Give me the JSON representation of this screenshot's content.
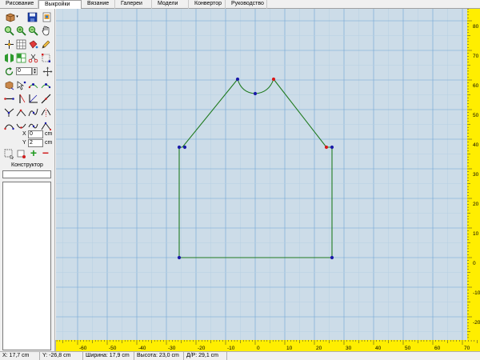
{
  "tabs": [
    {
      "label": "Рисование"
    },
    {
      "label": "Выкройки"
    },
    {
      "label": "Вязание"
    },
    {
      "label": "Галереи"
    },
    {
      "label": "Модели"
    },
    {
      "label": "Конвертор"
    },
    {
      "label": "Руководство"
    }
  ],
  "active_tab": "Выкройки",
  "panel": {
    "rotate_value": "0",
    "x_label": "X",
    "x_value": "0",
    "x_unit": "cm",
    "y_label": "Y",
    "y_value": "2",
    "y_unit": "cm",
    "add_symbol": "+",
    "remove_symbol": "−",
    "konstruktor_label": "Конструктор",
    "konstruktor_value": ""
  },
  "rulers": {
    "horizontal_labels": [
      "-60",
      "-50",
      "-40",
      "-30",
      "-20",
      "-10",
      "0",
      "10",
      "20",
      "30",
      "40",
      "50",
      "60",
      "70"
    ],
    "vertical_labels": [
      "80",
      "70",
      "60",
      "50",
      "40",
      "30",
      "20",
      "10",
      "0",
      "-10",
      "-20"
    ]
  },
  "status": {
    "x": "X: 17,7 cm",
    "y": "Y: -26,8 cm",
    "width": "Ширина: 17,9 cm",
    "height": "Высота: 23,0 cm",
    "diag": "Д/Р: 29,1 cm"
  },
  "colors": {
    "canvas_bg": "#ccdce8",
    "grid_minor": "#b6cfe2",
    "grid_major": "#6fa3d4",
    "pattern_line": "#1f7a1f",
    "node_blue": "#1a1aa8",
    "node_red": "#d81818",
    "ruler_bg": "#ffee00"
  }
}
